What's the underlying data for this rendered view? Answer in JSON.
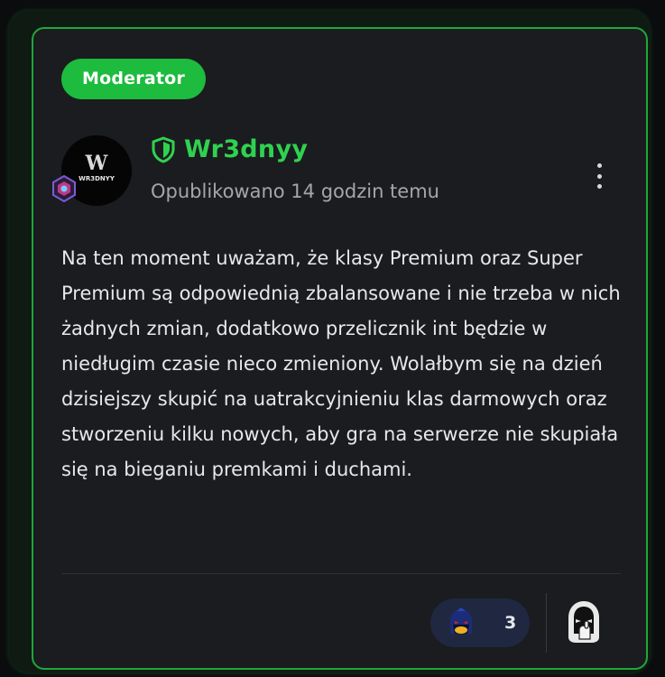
{
  "post": {
    "role_badge": "Moderator",
    "author": {
      "name": "Wr3dnyy",
      "avatar_text": "WR3DNYY",
      "avatar_initial": "W"
    },
    "timestamp": "Opublikowano 14 godzin temu",
    "body": "Na ten moment uważam, że klasy Premium oraz Super Premium są odpowiednią zbalansowane i nie trzeba w nich żadnych zmian, dodatkowo przelicznik int będzie w niedługim czasie nieco zmieniony. Wolałbym się na dzień dzisiejszy skupić na uatrakcyjnieniu klas darmowych oraz stworzeniu kilku nowych, aby gra na serwerze nie skupiała się na bieganiu premkami i duchami.",
    "reactions": {
      "count": "3"
    }
  },
  "colors": {
    "accent_green": "#1dbb3e",
    "author_green": "#2fd24f",
    "card_bg": "#1b1c1f",
    "reaction_bg": "#1f2840"
  },
  "icons": {
    "more": "more-vertical-icon",
    "shield": "shield-icon",
    "rank": "rank-badge-icon",
    "reaction": "reaction-avatar-icon",
    "react": "add-reaction-icon"
  }
}
